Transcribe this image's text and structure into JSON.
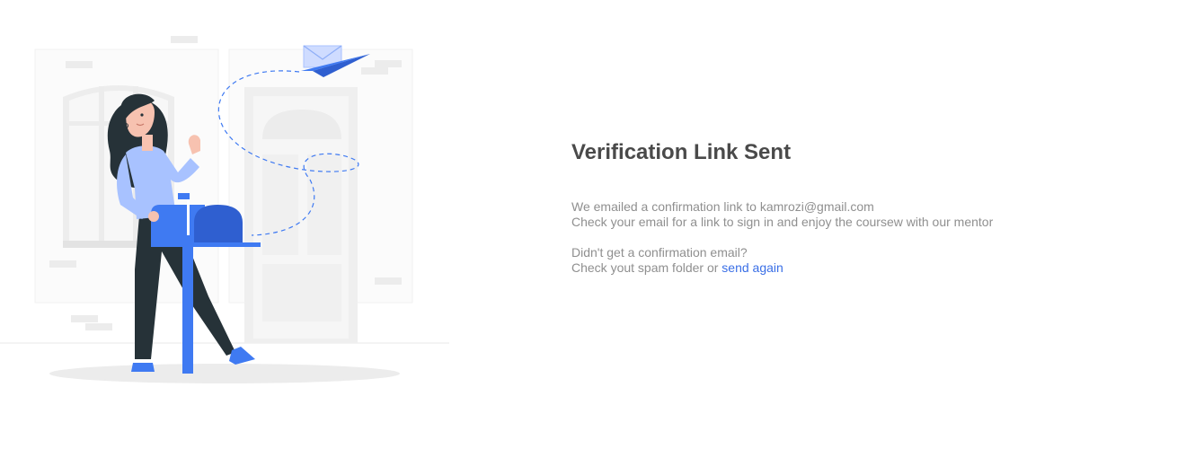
{
  "verification": {
    "title": "Verification Link Sent",
    "message": {
      "line1": "We emailed a confirmation link to kamrozi@gmail.com",
      "line2": "Check your email for a link to sign in and enjoy the coursew with our mentor"
    },
    "resend": {
      "question": "Didn't get a confirmation email?",
      "hint": "Check yout spam folder or ",
      "link_label": "send again"
    }
  },
  "illustration": {
    "name": "woman-mailbox-paper-plane-illustration"
  },
  "colors": {
    "title": "#4a4a4a",
    "body_text": "#8f8f8f",
    "link": "#3a6fe6",
    "accent_blue": "#3f7af2",
    "light_blue": "#a8c2ff",
    "background": "#ffffff"
  }
}
